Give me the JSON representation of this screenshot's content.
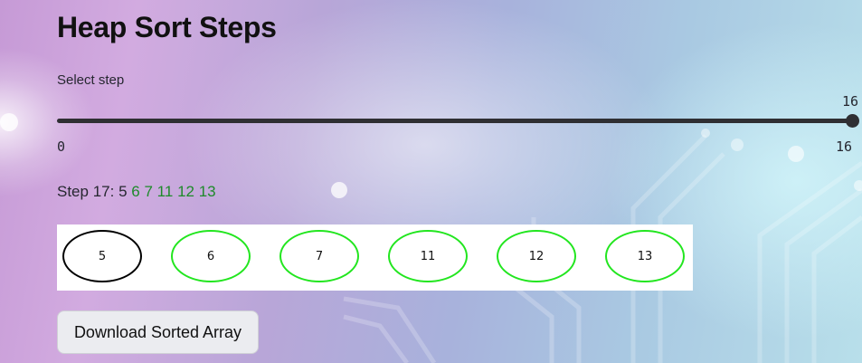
{
  "page": {
    "title": "Heap Sort Steps"
  },
  "slider": {
    "label": "Select step",
    "value": 16,
    "value_text": "16",
    "min": 0,
    "max": 16,
    "min_text": "0",
    "max_text": "16"
  },
  "step": {
    "prefix": "Step 17:",
    "current_value": "5",
    "sorted_values": [
      "6",
      "7",
      "11",
      "12",
      "13"
    ]
  },
  "heap": {
    "nodes": [
      {
        "label": "5",
        "state": "current"
      },
      {
        "label": "6",
        "state": "sorted"
      },
      {
        "label": "7",
        "state": "sorted"
      },
      {
        "label": "11",
        "state": "sorted"
      },
      {
        "label": "12",
        "state": "sorted"
      },
      {
        "label": "13",
        "state": "sorted"
      }
    ]
  },
  "download": {
    "label": "Download Sorted Array"
  },
  "colors": {
    "sorted_text": "#1e8a2a",
    "sorted_border": "#22e61f",
    "current_border": "#000000",
    "slider": "#2f2f33"
  }
}
